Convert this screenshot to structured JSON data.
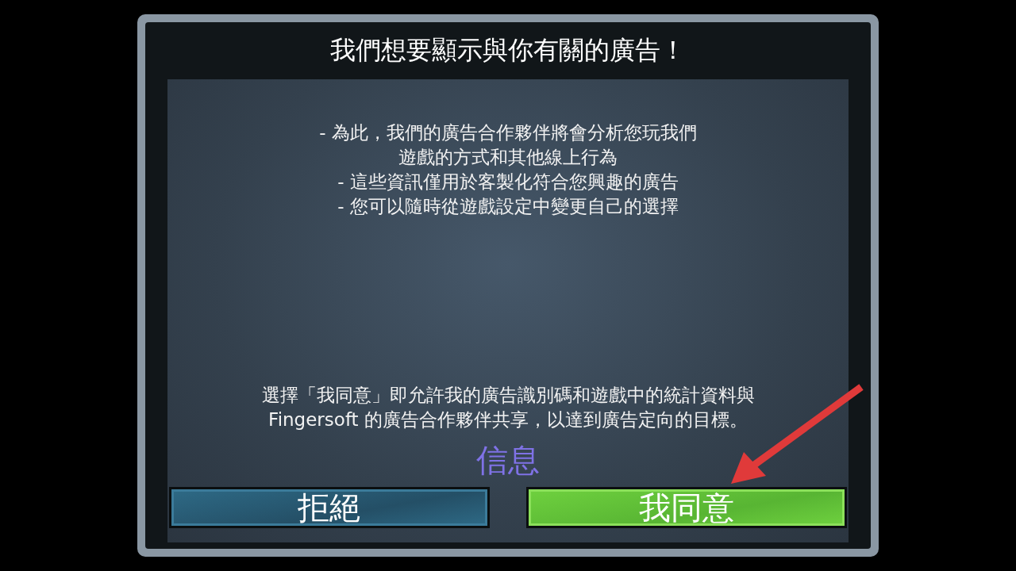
{
  "dialog": {
    "title": "我們想要顯示與你有關的廣告！",
    "info_lines": [
      "- 為此，我們的廣告合作夥伴將會分析您玩我們",
      "遊戲的方式和其他線上行為",
      "- 這些資訊僅用於客製化符合您興趣的廣告",
      "- 您可以隨時從遊戲設定中變更自己的選擇"
    ],
    "consent_lines": [
      "選擇「我同意」即允許我的廣告識別碼和遊戲中的統計資料與",
      "Fingersoft 的廣告合作夥伴共享，以達到廣告定向的目標。"
    ],
    "info_link": "信息",
    "buttons": [
      {
        "label": "拒絕",
        "kind": "decline"
      },
      {
        "label": "我同意",
        "kind": "accept"
      }
    ]
  },
  "annotation": {
    "kind": "arrow"
  }
}
